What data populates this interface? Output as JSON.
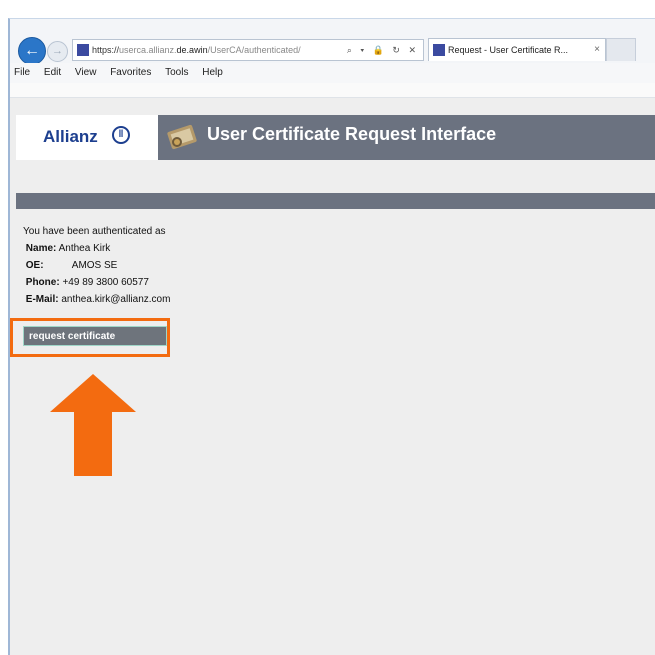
{
  "browser": {
    "address": {
      "scheme": "https://",
      "host_prefix": "userca.allianz.",
      "host_main": "de.awin",
      "path": "/UserCA/authenticated/",
      "tools": "⌕ ▾ 🔒 ↻ ✕"
    },
    "tab": {
      "title": "Request - User Certificate R...",
      "close": "×"
    },
    "menu": [
      "File",
      "Edit",
      "View",
      "Favorites",
      "Tools",
      "Help"
    ]
  },
  "page": {
    "logo_text": "Allianz",
    "logo_mark": "(|||)",
    "title": "User Certificate Request Interface",
    "auth_intro": "You have been authenticated as",
    "fields": [
      {
        "label": "Name:",
        "value": "Anthea Kirk"
      },
      {
        "label": "OE:",
        "value": "AMOS SE"
      },
      {
        "label": "Phone:",
        "value": "+49 89 3800 60577"
      },
      {
        "label": "E-Mail:",
        "value": "anthea.kirk@allianz.com"
      }
    ],
    "request_button": "request certificate"
  },
  "annotation": {
    "highlight_color": "#f36b10",
    "arrow_color": "#f36b10"
  }
}
